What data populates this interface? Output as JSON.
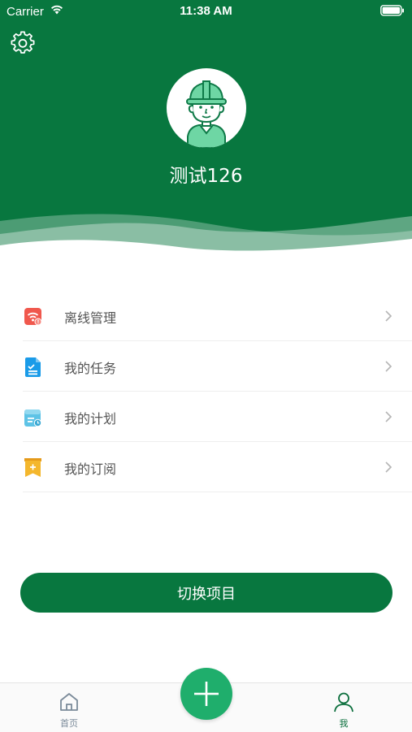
{
  "status_bar": {
    "carrier": "Carrier",
    "time": "11:38 AM"
  },
  "header": {
    "username": "测试126",
    "avatar_icon": "worker-hardhat-avatar",
    "settings_icon": "gear-icon",
    "background_color": "#08773f"
  },
  "menu": {
    "items": [
      {
        "label": "离线管理",
        "icon": "offline-wifi-icon",
        "color": "#f0584d"
      },
      {
        "label": "我的任务",
        "icon": "task-document-icon",
        "color": "#1a9be8"
      },
      {
        "label": "我的计划",
        "icon": "plan-calendar-icon",
        "color": "#5ec3e6"
      },
      {
        "label": "我的订阅",
        "icon": "subscription-bookmark-icon",
        "color": "#f4b72d"
      }
    ]
  },
  "switch_project": {
    "label": "切换项目"
  },
  "tabbar": {
    "home_label": "首页",
    "me_label": "我",
    "active_tab": "我"
  }
}
